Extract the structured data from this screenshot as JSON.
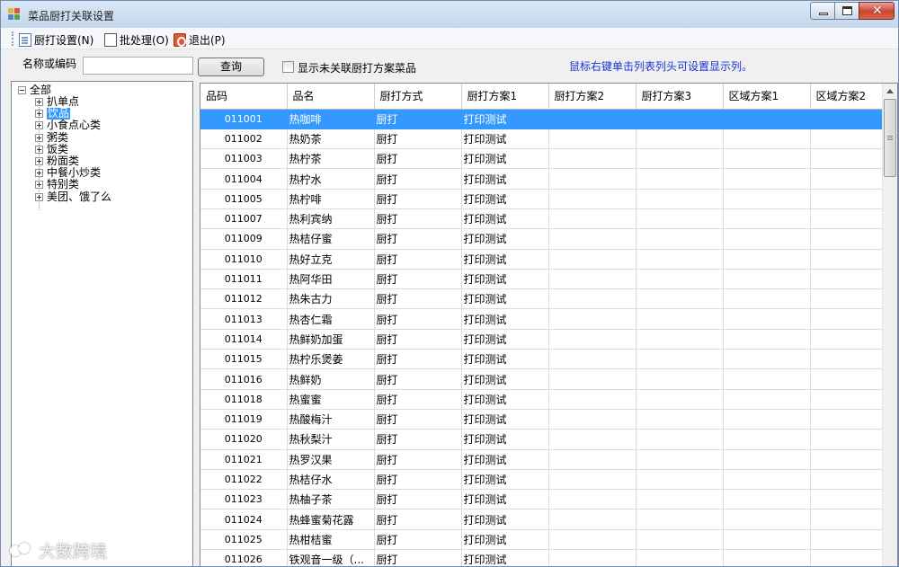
{
  "window": {
    "title": "菜品厨打关联设置",
    "close_glyph": "✕"
  },
  "menu": [
    {
      "label": "厨打设置(N)",
      "icon": "document-icon"
    },
    {
      "label": "批处理(O)",
      "icon": "batch-icon"
    },
    {
      "label": "退出(P)",
      "icon": "exit-icon"
    }
  ],
  "search": {
    "label": "名称或编码",
    "value": "",
    "placeholder": "",
    "button": "查询",
    "checkbox_label": "显示未关联厨打方案菜品",
    "checkbox_checked": false,
    "hint": "鼠标右键单击列表列头可设置显示列。"
  },
  "tree": {
    "root": "全部",
    "selected": "饮品",
    "children": [
      "扒单点",
      "饮品",
      "小食点心类",
      "粥类",
      "饭类",
      "粉面类",
      "中餐小炒类",
      "特别类",
      "美团、饿了么"
    ]
  },
  "grid": {
    "columns": [
      "品码",
      "品名",
      "厨打方式",
      "厨打方案1",
      "厨打方案2",
      "厨打方案3",
      "区域方案1",
      "区域方案2"
    ],
    "selected_row": 0,
    "rows": [
      [
        "011001",
        "热咖啡",
        "厨打",
        "打印测试",
        "",
        "",
        "",
        ""
      ],
      [
        "011002",
        "热奶茶",
        "厨打",
        "打印测试",
        "",
        "",
        "",
        ""
      ],
      [
        "011003",
        "热柠茶",
        "厨打",
        "打印测试",
        "",
        "",
        "",
        ""
      ],
      [
        "011004",
        "热柠水",
        "厨打",
        "打印测试",
        "",
        "",
        "",
        ""
      ],
      [
        "011005",
        "热柠啡",
        "厨打",
        "打印测试",
        "",
        "",
        "",
        ""
      ],
      [
        "011007",
        "热利宾纳",
        "厨打",
        "打印测试",
        "",
        "",
        "",
        ""
      ],
      [
        "011009",
        "热桔仔蜜",
        "厨打",
        "打印测试",
        "",
        "",
        "",
        ""
      ],
      [
        "011010",
        "热好立克",
        "厨打",
        "打印测试",
        "",
        "",
        "",
        ""
      ],
      [
        "011011",
        "热阿华田",
        "厨打",
        "打印测试",
        "",
        "",
        "",
        ""
      ],
      [
        "011012",
        "热朱古力",
        "厨打",
        "打印测试",
        "",
        "",
        "",
        ""
      ],
      [
        "011013",
        "热杏仁霜",
        "厨打",
        "打印测试",
        "",
        "",
        "",
        ""
      ],
      [
        "011014",
        "热鲜奶加蛋",
        "厨打",
        "打印测试",
        "",
        "",
        "",
        ""
      ],
      [
        "011015",
        "热柠乐煲姜",
        "厨打",
        "打印测试",
        "",
        "",
        "",
        ""
      ],
      [
        "011016",
        "热鲜奶",
        "厨打",
        "打印测试",
        "",
        "",
        "",
        ""
      ],
      [
        "011018",
        "热蜜蜜",
        "厨打",
        "打印测试",
        "",
        "",
        "",
        ""
      ],
      [
        "011019",
        "热酸梅汁",
        "厨打",
        "打印测试",
        "",
        "",
        "",
        ""
      ],
      [
        "011020",
        "热秋梨汁",
        "厨打",
        "打印测试",
        "",
        "",
        "",
        ""
      ],
      [
        "011021",
        "热罗汉果",
        "厨打",
        "打印测试",
        "",
        "",
        "",
        ""
      ],
      [
        "011022",
        "热桔仔水",
        "厨打",
        "打印测试",
        "",
        "",
        "",
        ""
      ],
      [
        "011023",
        "热柚子茶",
        "厨打",
        "打印测试",
        "",
        "",
        "",
        ""
      ],
      [
        "011024",
        "热蜂蜜菊花露",
        "厨打",
        "打印测试",
        "",
        "",
        "",
        ""
      ],
      [
        "011025",
        "热柑桔蜜",
        "厨打",
        "打印测试",
        "",
        "",
        "",
        ""
      ],
      [
        "011026",
        "铁观音一级（...",
        "厨打",
        "打印测试",
        "",
        "",
        "",
        ""
      ]
    ]
  },
  "watermark": "大数跨境",
  "colors": {
    "selection": "#3399ff",
    "hint": "#1b33d6"
  }
}
